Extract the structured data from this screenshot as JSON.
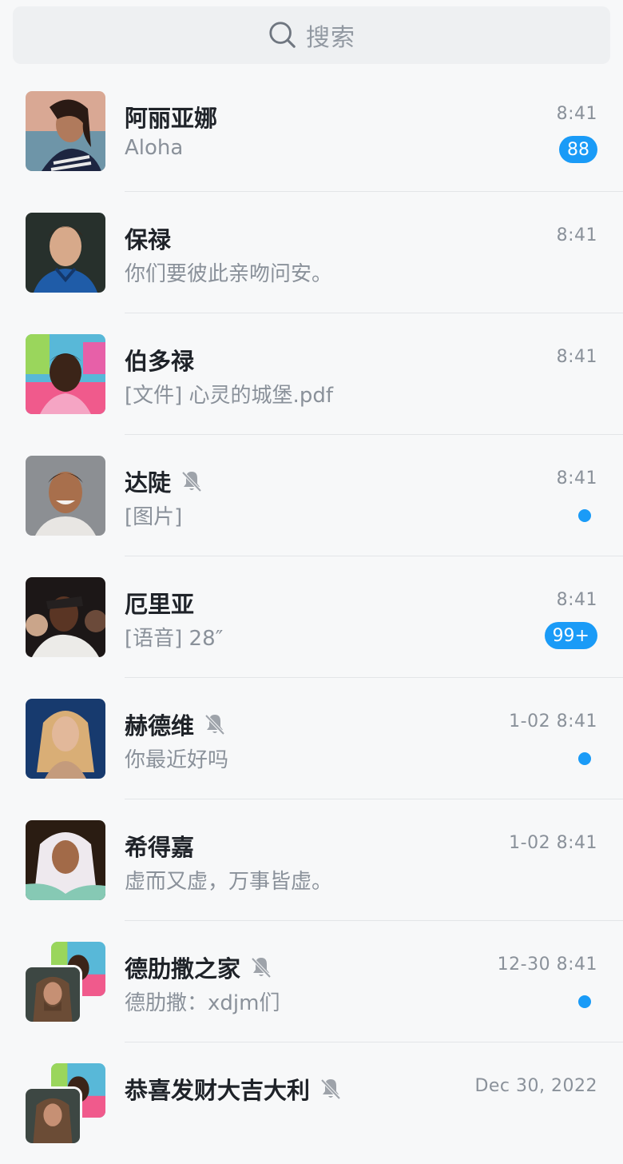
{
  "search": {
    "placeholder": "搜索",
    "icon": "search-icon"
  },
  "accent_color": "#1a9bf7",
  "conversations": [
    {
      "name": "阿丽亚娜",
      "preview": "Aloha",
      "time": "8:41",
      "badge": "88",
      "muted": false
    },
    {
      "name": "保禄",
      "preview": "你们要彼此亲吻问安。",
      "time": "8:41",
      "muted": false
    },
    {
      "name": "伯多禄",
      "preview": "[文件] 心灵的城堡.pdf",
      "time": "8:41",
      "muted": false
    },
    {
      "name": "达陡",
      "preview": "[图片]",
      "time": "8:41",
      "dot": true,
      "muted": true
    },
    {
      "name": "厄里亚",
      "preview": "[语音] 28″",
      "time": "8:41",
      "badge": "99+",
      "muted": false
    },
    {
      "name": "赫德维",
      "preview": "你最近好吗",
      "time": "1-02 8:41",
      "dot": true,
      "muted": true
    },
    {
      "name": "希得嘉",
      "preview": "虚而又虚，万事皆虚。",
      "time": "1-02 8:41",
      "muted": false
    },
    {
      "name": "德肋撒之家",
      "preview": "德肋撒：xdjm们",
      "time": "12-30 8:41",
      "dot": true,
      "muted": true,
      "group": true
    },
    {
      "name": "恭喜发财大吉大利",
      "preview": "",
      "time": "Dec 30, 2022",
      "muted": true,
      "group": true
    }
  ]
}
